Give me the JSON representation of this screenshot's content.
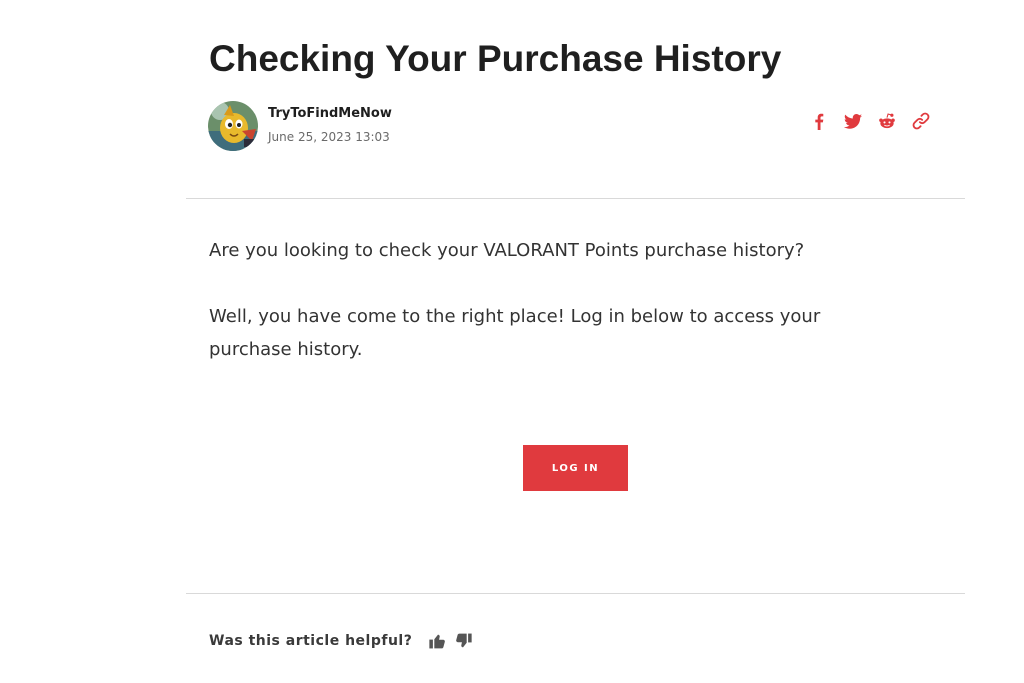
{
  "article": {
    "title": "Checking Your Purchase History",
    "author": "TryToFindMeNow",
    "date": "June 25, 2023 13:03",
    "paragraphs": [
      "Are you looking to check your VALORANT Points purchase history?",
      "Well, you have come to the right place! Log in below to access your purchase history."
    ],
    "login_label": "LOG IN"
  },
  "share": {
    "icons": [
      "facebook-icon",
      "twitter-icon",
      "reddit-icon",
      "link-icon"
    ]
  },
  "feedback": {
    "question": "Was this article helpful?",
    "icons": [
      "thumbs-up-icon",
      "thumbs-down-icon"
    ]
  },
  "colors": {
    "accent": "#e03a3e",
    "title": "#1f1f1f",
    "body_text": "#333333",
    "meta_text": "#6a6a6a",
    "divider": "#d9d9d9"
  }
}
